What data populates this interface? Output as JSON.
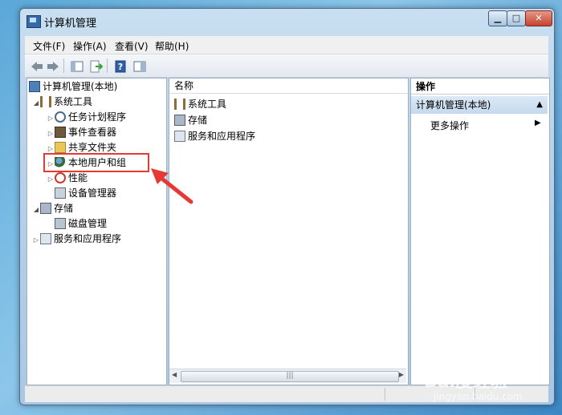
{
  "window": {
    "title": "计算机管理"
  },
  "menu": [
    "文件(F)",
    "操作(A)",
    "查看(V)",
    "帮助(H)"
  ],
  "tree": {
    "root": "计算机管理(本地)",
    "system_tools": "系统工具",
    "task_scheduler": "任务计划程序",
    "event_viewer": "事件查看器",
    "shared_folders": "共享文件夹",
    "local_users": "本地用户和组",
    "performance": "性能",
    "device_manager": "设备管理器",
    "storage": "存储",
    "disk_management": "磁盘管理",
    "services_apps": "服务和应用程序"
  },
  "list": {
    "header": "名称",
    "items": [
      "系统工具",
      "存储",
      "服务和应用程序"
    ]
  },
  "actions": {
    "header": "操作",
    "section": "计算机管理(本地)",
    "more": "更多操作"
  },
  "watermark": {
    "logo": "Bai度经验",
    "url": "jingyan.baidu.com"
  },
  "colors": {
    "highlight": "#e53935",
    "arrow": "#e53935"
  }
}
